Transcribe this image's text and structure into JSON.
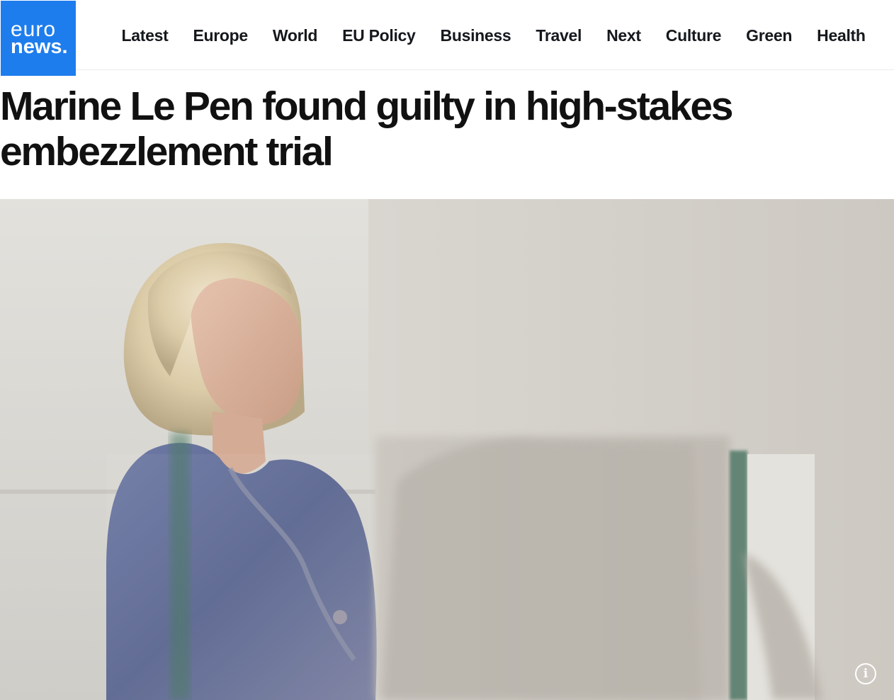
{
  "brand": {
    "logo_line1": "euro",
    "logo_line2": "news",
    "logo_dot": ".",
    "color": "#1e7ded"
  },
  "nav": {
    "items": [
      {
        "label": "Latest"
      },
      {
        "label": "Europe"
      },
      {
        "label": "World"
      },
      {
        "label": "EU Policy"
      },
      {
        "label": "Business"
      },
      {
        "label": "Travel"
      },
      {
        "label": "Next"
      },
      {
        "label": "Culture"
      },
      {
        "label": "Green"
      },
      {
        "label": "Health"
      }
    ]
  },
  "article": {
    "headline": "Marine Le Pen found guilty in high-stakes embezzlement trial"
  },
  "hero": {
    "info_icon": "info-icon",
    "info_glyph": "i"
  }
}
